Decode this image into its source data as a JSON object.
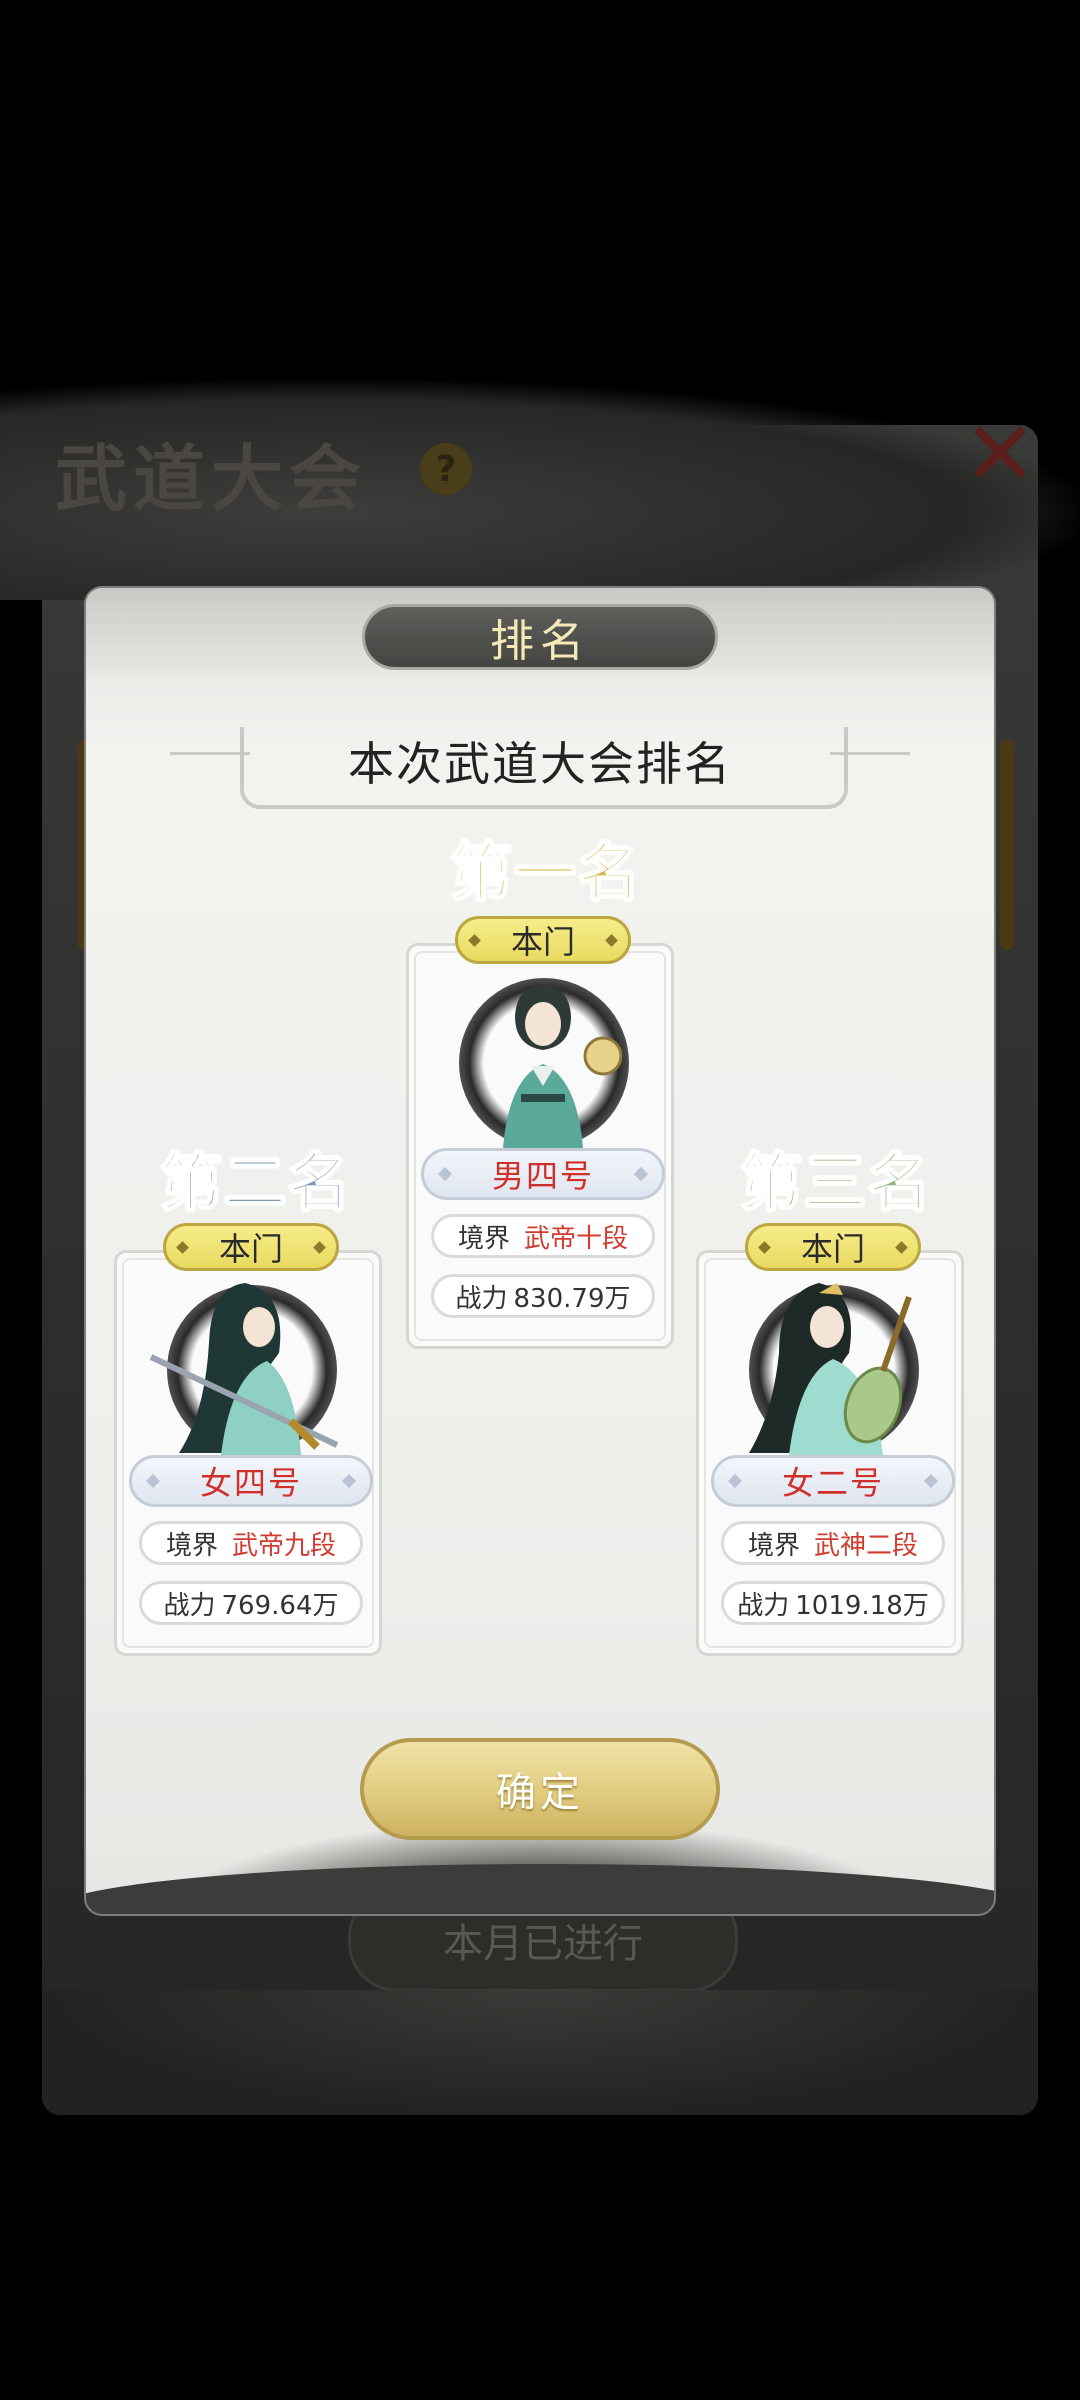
{
  "background": {
    "title": "武道大会",
    "help_icon": "?",
    "bottom_button": "本月已进行"
  },
  "dialog": {
    "header": "排名",
    "subtitle": "本次武道大会排名",
    "confirm": "确定"
  },
  "podium": [
    {
      "place": "第一名",
      "place_color": "#d9b64a",
      "sect": "本门",
      "name": "男四号",
      "realm_label": "境界",
      "realm": "武帝十段",
      "power_label": "战力",
      "power": "830.79万",
      "portrait_icon": "male-swordsman-portrait"
    },
    {
      "place": "第二名",
      "place_color": "#7e9bb5",
      "sect": "本门",
      "name": "女四号",
      "realm_label": "境界",
      "realm": "武帝九段",
      "power_label": "战力",
      "power": "769.64万",
      "portrait_icon": "female-swordswoman-portrait"
    },
    {
      "place": "第三名",
      "place_color": "#8bb57a",
      "sect": "本门",
      "name": "女二号",
      "realm_label": "境界",
      "realm": "武神二段",
      "power_label": "战力",
      "power": "1019.18万",
      "portrait_icon": "female-pipa-player-portrait"
    }
  ]
}
